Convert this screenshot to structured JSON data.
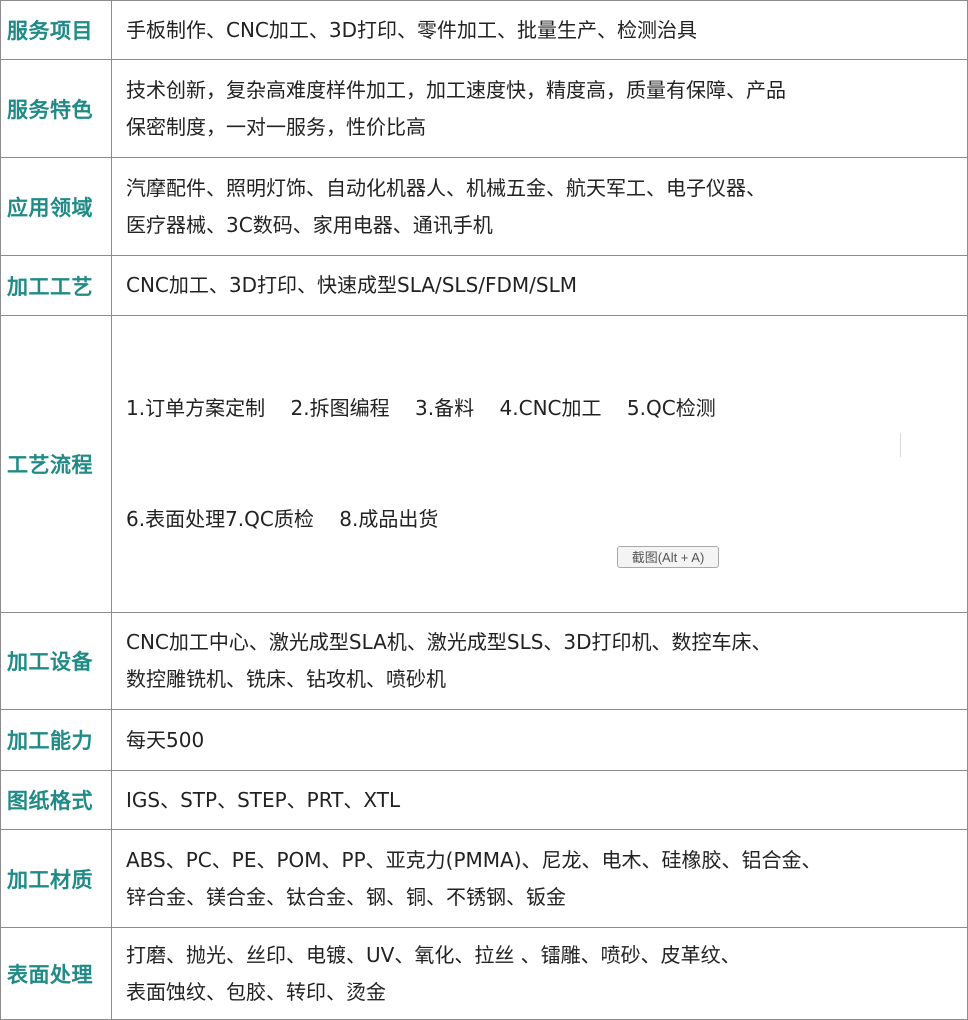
{
  "rows": [
    {
      "label": "服务项目",
      "lines": [
        "手板制作、CNC加工、3D打印、零件加工、批量生产、检测治具"
      ]
    },
    {
      "label": "服务特色",
      "lines": [
        "技术创新，复杂高难度样件加工，加工速度快，精度高，质量有保障、产品",
        "保密制度，一对一服务，性价比高"
      ]
    },
    {
      "label": "应用领域",
      "lines": [
        "汽摩配件、照明灯饰、自动化机器人、机械五金、航天军工、电子仪器、",
        "医疗器械、3C数码、家用电器、通讯手机"
      ]
    },
    {
      "label": "加工工艺",
      "lines": [
        "CNC加工、3D打印、快速成型SLA/SLS/FDM/SLM"
      ]
    },
    {
      "label": "工艺流程",
      "lines": [
        "1.订单方案定制    2.拆图编程    3.备料    4.CNC加工    5.QC检测",
        "6.表面处理7.QC质检    8.成品出货"
      ]
    },
    {
      "label": "加工设备",
      "lines": [
        "CNC加工中心、激光成型SLA机、激光成型SLS、3D打印机、数控车床、",
        "数控雕铣机、铣床、钻攻机、喷砂机"
      ]
    },
    {
      "label": "加工能力",
      "lines": [
        "每天500"
      ]
    },
    {
      "label": "图纸格式",
      "lines": [
        "IGS、STP、STEP、PRT、XTL"
      ]
    },
    {
      "label": "加工材质",
      "lines": [
        "ABS、PC、PE、POM、PP、亚克力(PMMA)、尼龙、电木、硅橡胶、铝合金、",
        "锌合金、镁合金、钛合金、钢、铜、不锈钢、钣金"
      ]
    },
    {
      "label": "表面处理",
      "lines": [
        "打磨、抛光、丝印、电镀、UV、氧化、拉丝 、镭雕、喷砂、皮革纹、",
        "表面蚀纹、包胶、转印、烫金"
      ]
    }
  ],
  "overlay": {
    "screenshot_hint": "截图(Alt + A)"
  }
}
